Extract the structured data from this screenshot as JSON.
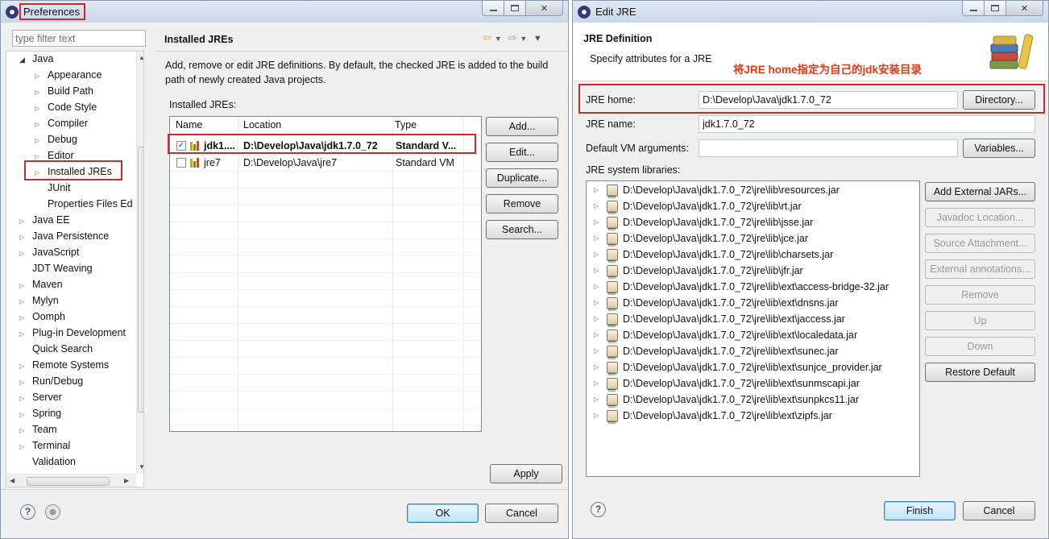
{
  "preferences": {
    "title": "Preferences",
    "filter_placeholder": "type filter text",
    "tree": [
      {
        "label": "Java",
        "level": 0,
        "expander": "open"
      },
      {
        "label": "Appearance",
        "level": 1,
        "expander": "closed"
      },
      {
        "label": "Build Path",
        "level": 1,
        "expander": "closed"
      },
      {
        "label": "Code Style",
        "level": 1,
        "expander": "closed"
      },
      {
        "label": "Compiler",
        "level": 1,
        "expander": "closed"
      },
      {
        "label": "Debug",
        "level": 1,
        "expander": "closed"
      },
      {
        "label": "Editor",
        "level": 1,
        "expander": "closed"
      },
      {
        "label": "Installed JREs",
        "level": 1,
        "expander": "closed",
        "selected": true
      },
      {
        "label": "JUnit",
        "level": 1,
        "expander": "none"
      },
      {
        "label": "Properties Files Ed",
        "level": 1,
        "expander": "none"
      },
      {
        "label": "Java EE",
        "level": 0,
        "expander": "closed"
      },
      {
        "label": "Java Persistence",
        "level": 0,
        "expander": "closed"
      },
      {
        "label": "JavaScript",
        "level": 0,
        "expander": "closed"
      },
      {
        "label": "JDT Weaving",
        "level": 0,
        "expander": "none"
      },
      {
        "label": "Maven",
        "level": 0,
        "expander": "closed"
      },
      {
        "label": "Mylyn",
        "level": 0,
        "expander": "closed"
      },
      {
        "label": "Oomph",
        "level": 0,
        "expander": "closed"
      },
      {
        "label": "Plug-in Development",
        "level": 0,
        "expander": "closed"
      },
      {
        "label": "Quick Search",
        "level": 0,
        "expander": "none"
      },
      {
        "label": "Remote Systems",
        "level": 0,
        "expander": "closed"
      },
      {
        "label": "Run/Debug",
        "level": 0,
        "expander": "closed"
      },
      {
        "label": "Server",
        "level": 0,
        "expander": "closed"
      },
      {
        "label": "Spring",
        "level": 0,
        "expander": "closed"
      },
      {
        "label": "Team",
        "level": 0,
        "expander": "closed"
      },
      {
        "label": "Terminal",
        "level": 0,
        "expander": "closed"
      },
      {
        "label": "Validation",
        "level": 0,
        "expander": "none"
      }
    ],
    "page_title": "Installed JREs",
    "description": "Add, remove or edit JRE definitions. By default, the checked JRE is added to the build path of newly created Java projects.",
    "installed_label": "Installed JREs:",
    "table": {
      "columns": [
        "Name",
        "Location",
        "Type"
      ],
      "rows": [
        {
          "checked": true,
          "name": "jdk1....",
          "location": "D:\\Develop\\Java\\jdk1.7.0_72",
          "type": "Standard V...",
          "bold": true
        },
        {
          "checked": false,
          "name": "jre7",
          "location": "D:\\Develop\\Java\\jre7",
          "type": "Standard VM",
          "bold": false
        }
      ]
    },
    "side_buttons": [
      "Add...",
      "Edit...",
      "Duplicate...",
      "Remove",
      "Search..."
    ],
    "apply": "Apply",
    "ok": "OK",
    "cancel": "Cancel",
    "icons": {
      "help": "help-icon",
      "record": "record-macro-icon",
      "back": "back-arrow-icon",
      "forward": "forward-arrow-icon",
      "menu": "view-menu-icon"
    }
  },
  "edit_jre": {
    "title": "Edit JRE",
    "header_title": "JRE Definition",
    "header_subtitle": "Specify attributes for a JRE",
    "annotation": "将JRE home指定为自己的jdk安装目录",
    "jre_home_label": "JRE home:",
    "jre_home_value": "D:\\Develop\\Java\\jdk1.7.0_72",
    "directory_button": "Directory...",
    "jre_name_label": "JRE name:",
    "jre_name_value": "jdk1.7.0_72",
    "vm_args_label": "Default VM arguments:",
    "vm_args_value": "",
    "variables_button": "Variables...",
    "libraries_label": "JRE system libraries:",
    "libraries": [
      "D:\\Develop\\Java\\jdk1.7.0_72\\jre\\lib\\resources.jar",
      "D:\\Develop\\Java\\jdk1.7.0_72\\jre\\lib\\rt.jar",
      "D:\\Develop\\Java\\jdk1.7.0_72\\jre\\lib\\jsse.jar",
      "D:\\Develop\\Java\\jdk1.7.0_72\\jre\\lib\\jce.jar",
      "D:\\Develop\\Java\\jdk1.7.0_72\\jre\\lib\\charsets.jar",
      "D:\\Develop\\Java\\jdk1.7.0_72\\jre\\lib\\jfr.jar",
      "D:\\Develop\\Java\\jdk1.7.0_72\\jre\\lib\\ext\\access-bridge-32.jar",
      "D:\\Develop\\Java\\jdk1.7.0_72\\jre\\lib\\ext\\dnsns.jar",
      "D:\\Develop\\Java\\jdk1.7.0_72\\jre\\lib\\ext\\jaccess.jar",
      "D:\\Develop\\Java\\jdk1.7.0_72\\jre\\lib\\ext\\localedata.jar",
      "D:\\Develop\\Java\\jdk1.7.0_72\\jre\\lib\\ext\\sunec.jar",
      "D:\\Develop\\Java\\jdk1.7.0_72\\jre\\lib\\ext\\sunjce_provider.jar",
      "D:\\Develop\\Java\\jdk1.7.0_72\\jre\\lib\\ext\\sunmscapi.jar",
      "D:\\Develop\\Java\\jdk1.7.0_72\\jre\\lib\\ext\\sunpkcs11.jar",
      "D:\\Develop\\Java\\jdk1.7.0_72\\jre\\lib\\ext\\zipfs.jar"
    ],
    "lib_buttons": [
      {
        "label": "Add External JARs...",
        "enabled": true
      },
      {
        "label": "Javadoc Location...",
        "enabled": false
      },
      {
        "label": "Source Attachment...",
        "enabled": false
      },
      {
        "label": "External annotations...",
        "enabled": false
      },
      {
        "label": "Remove",
        "enabled": false
      },
      {
        "label": "Up",
        "enabled": false
      },
      {
        "label": "Down",
        "enabled": false
      },
      {
        "label": "Restore Default",
        "enabled": true
      }
    ],
    "finish": "Finish",
    "cancel": "Cancel"
  },
  "colors": {
    "highlight_border": "#d0272f",
    "annotation_text": "#e23a14",
    "default_button": "#3c7fb1"
  }
}
